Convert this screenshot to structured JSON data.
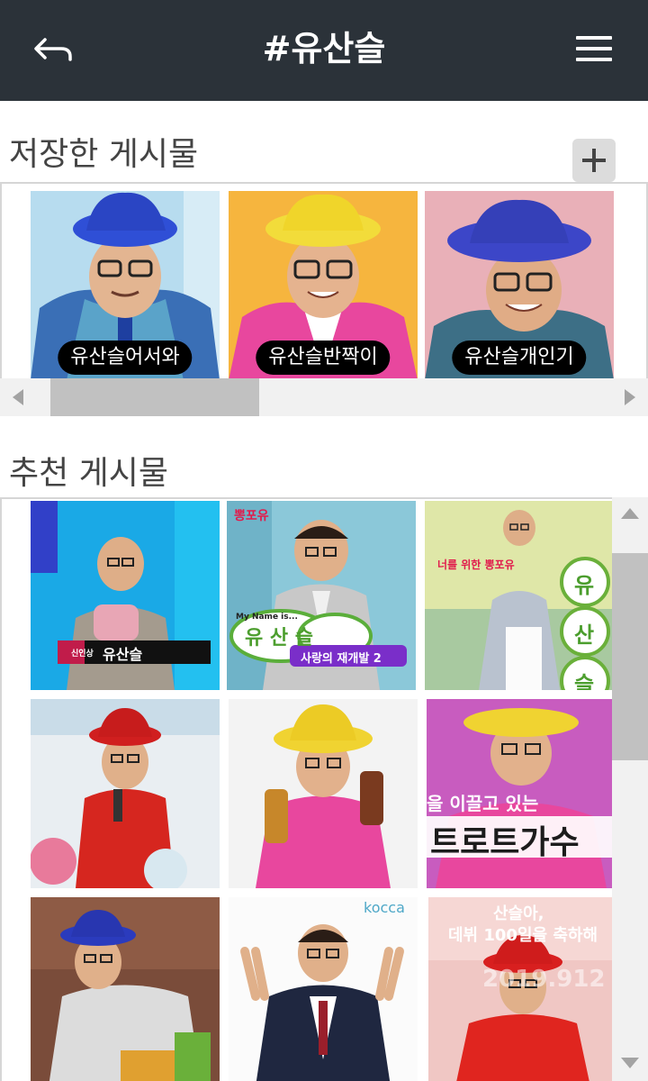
{
  "header": {
    "title": "#유산슬"
  },
  "saved": {
    "title": "저장한 게시물",
    "cards": [
      {
        "label": "유산슬어서와"
      },
      {
        "label": "유산슬반짝이"
      },
      {
        "label": "유산슬개인기"
      }
    ]
  },
  "recommended": {
    "title": "추천 게시물",
    "texts": {
      "award_name": "유산슬",
      "award_title": "신인상",
      "ppongpo1": "뽕포유",
      "myname1": "My Name is...",
      "yusanseul1": "유 산 슬",
      "redevelop": "사랑의 재개발 2",
      "ppongpo2": "너를 위한 뽕포유",
      "myname2": "MY NAME IS...",
      "yu": "유",
      "san": "산",
      "seul": "슬",
      "leading": "을 이끌고 있는",
      "trot": "트로트가수",
      "kocca": "kocca",
      "anniv1": "산슬아,",
      "anniv2": "데뷔 100일을 축하해",
      "year": "2019.912"
    }
  }
}
